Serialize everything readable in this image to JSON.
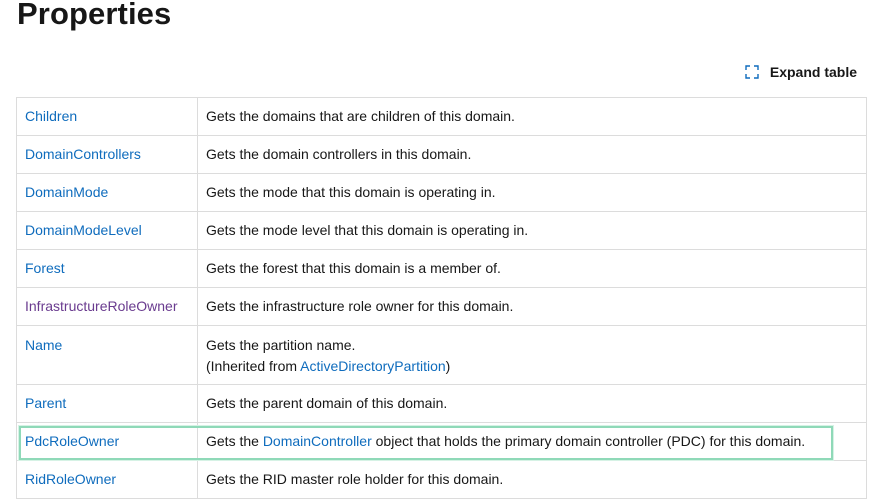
{
  "page": {
    "title": "Properties"
  },
  "toolbar": {
    "expand_label": "Expand table",
    "expand_icon": "expand-icon"
  },
  "colors": {
    "link": "#0f6cbd",
    "visited_link": "#6a3b8f",
    "focus_outline": "#8fd9b8",
    "border": "#dcdcdc"
  },
  "properties": [
    {
      "name": "Children",
      "description": "Gets the domains that are children of this domain."
    },
    {
      "name": "DomainControllers",
      "description": "Gets the domain controllers in this domain."
    },
    {
      "name": "DomainMode",
      "description": "Gets the mode that this domain is operating in."
    },
    {
      "name": "DomainModeLevel",
      "description": "Gets the mode level that this domain is operating in."
    },
    {
      "name": "Forest",
      "description": "Gets the forest that this domain is a member of."
    },
    {
      "name": "InfrastructureRoleOwner",
      "description": "Gets the infrastructure role owner for this domain.",
      "visited": true
    },
    {
      "name": "Name",
      "description": "Gets the partition name.",
      "inherited_prefix": "(Inherited from ",
      "inherited_link": "ActiveDirectoryPartition",
      "inherited_suffix": ")"
    },
    {
      "name": "Parent",
      "description": "Gets the parent domain of this domain."
    },
    {
      "name": "PdcRoleOwner",
      "description_prefix": "Gets the ",
      "description_link": "DomainController",
      "description_suffix": " object that holds the primary domain controller (PDC) for this domain.",
      "focused": true
    },
    {
      "name": "RidRoleOwner",
      "description": "Gets the RID master role holder for this domain."
    }
  ]
}
